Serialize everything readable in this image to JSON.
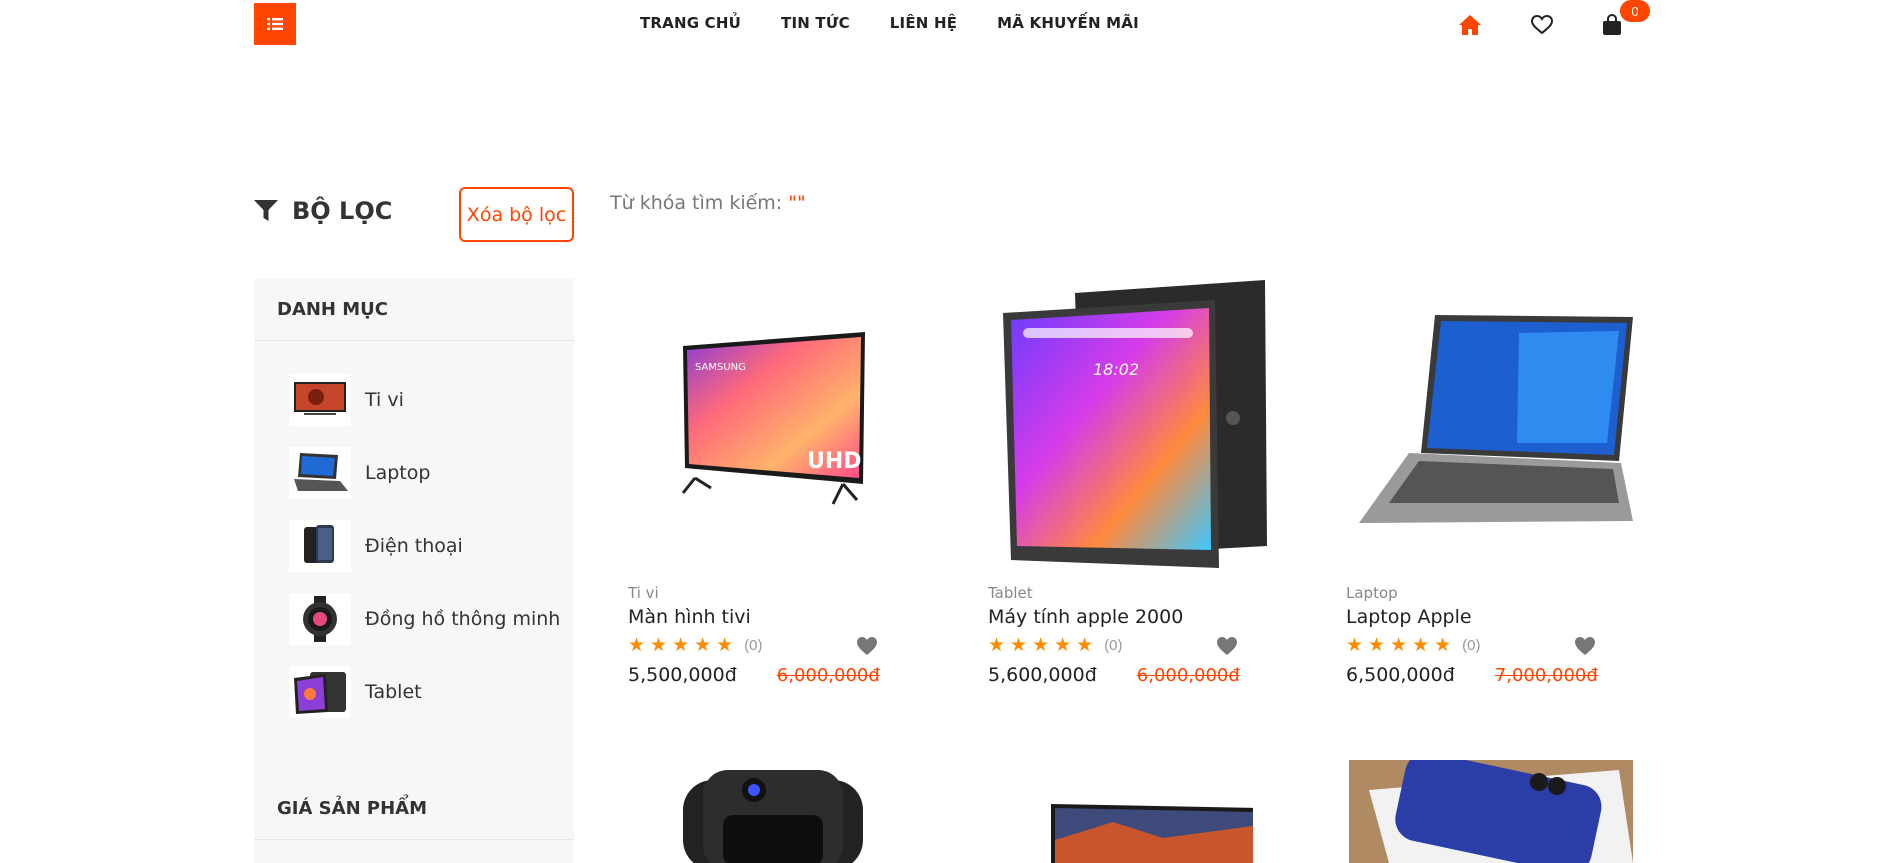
{
  "header": {
    "nav": [
      "TRANG CHỦ",
      "TIN TỨC",
      "LIÊN HỆ",
      "MÃ KHUYẾN MÃI"
    ],
    "cart_count": "0",
    "icons": {
      "menu": "list-icon",
      "home": "home-icon",
      "wishlist": "heart-icon",
      "cart": "shopping-bag-icon"
    },
    "accent": "#ff4500"
  },
  "filter": {
    "title": "BỘ LỌC",
    "clear_label": "Xóa bộ lọc",
    "keyword_label": "Từ khóa tìm kiếm:",
    "keyword_value": "\"\""
  },
  "sidebar": {
    "category_heading": "DANH MỤC",
    "categories": [
      {
        "label": "Ti vi"
      },
      {
        "label": "Laptop"
      },
      {
        "label": "Điện thoại"
      },
      {
        "label": "Đồng hồ thông minh"
      },
      {
        "label": "Tablet"
      }
    ],
    "price_heading": "GIÁ SẢN PHẨM"
  },
  "products": [
    {
      "category": "Ti vi",
      "name": "Màn hình tivi",
      "rating_count": "(0)",
      "price": "5,500,000đ",
      "old_price": "6,000,000đ"
    },
    {
      "category": "Tablet",
      "name": "Máy tính apple 2000",
      "rating_count": "(0)",
      "price": "5,600,000đ",
      "old_price": "6,000,000đ"
    },
    {
      "category": "Laptop",
      "name": "Laptop Apple",
      "rating_count": "(0)",
      "price": "6,500,000đ",
      "old_price": "7,000,000đ"
    }
  ],
  "stars": "★★★★★"
}
